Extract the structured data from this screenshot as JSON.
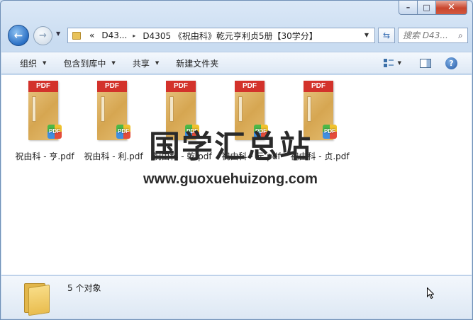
{
  "window": {
    "caption_minimize": "–",
    "caption_maximize": "□",
    "caption_close": "✕"
  },
  "nav": {
    "back_glyph": "←",
    "forward_glyph": "→",
    "history_glyph": "▼",
    "address_prefix": "«",
    "address_crumb1": "D43...",
    "address_crumb2": "D4305 《祝由科》乾元亨利贞5册【30学分】",
    "crumb_separator": "▸",
    "address_dropdown": "▼",
    "refresh_glyph": "⇆",
    "search_placeholder": "搜索 D43...",
    "search_glyph": "⌕"
  },
  "toolbar": {
    "organize": "组织",
    "include_library": "包含到库中",
    "share": "共享",
    "new_folder": "新建文件夹",
    "caret": "▼",
    "help_glyph": "?"
  },
  "files": [
    {
      "name": "祝由科 - 亨.pdf",
      "band": "PDF",
      "badge": "PDF"
    },
    {
      "name": "祝由科 - 利.pdf",
      "band": "PDF",
      "badge": "PDF"
    },
    {
      "name": "祝由科 - 乾.pdf",
      "band": "PDF",
      "badge": "PDF"
    },
    {
      "name": "祝由科 - 元.pdf",
      "band": "PDF",
      "badge": "PDF"
    },
    {
      "name": "祝由科 - 贞.pdf",
      "band": "PDF",
      "badge": "PDF"
    }
  ],
  "watermark": {
    "logo": "国学汇总站",
    "url": "www.guoxuehuizong.com"
  },
  "status": {
    "count": "5 个对象"
  }
}
